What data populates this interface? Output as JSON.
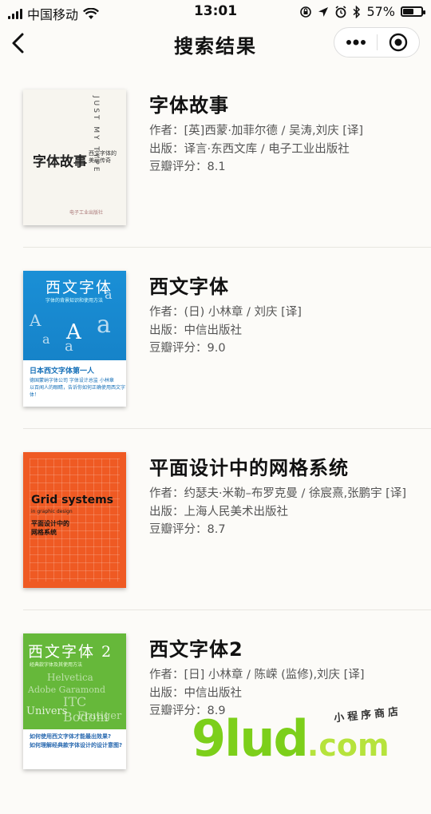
{
  "status_bar": {
    "carrier": "中国移动",
    "time": "13:01",
    "battery_percent": "57%",
    "battery_level": 0.57
  },
  "nav": {
    "title": "搜索结果"
  },
  "books": [
    {
      "title": "字体故事",
      "author": "作者：[英]西蒙·加菲尔德 / 吴涛,刘庆 [译]",
      "publisher": "出版：译言·东西文库 / 电子工业出版社",
      "rating": "豆瓣评分：8.1",
      "cover": {
        "main": "字体故事",
        "sub1": "西文字体的",
        "sub2": "美丽传奇",
        "vertical": "JUST MY TYPE",
        "pub": "电子工业出版社"
      }
    },
    {
      "title": "西文字体",
      "author": "作者：(日) 小林章 / 刘庆 [译]",
      "publisher": "出版：中信出版社",
      "rating": "豆瓣评分：9.0",
      "cover": {
        "main": "西文字体",
        "sub": "字体的背景知识和使用方法",
        "band1": "日本西文字体第一人",
        "band2": "德国蒙纳字体公司 字体设计总监 小林章",
        "band3": "以百闻人的眼睛，告诉你如何正确使用西文字体！"
      }
    },
    {
      "title": "平面设计中的网格系统",
      "author": "作者：约瑟夫·米勒–布罗克曼 / 徐宸熹,张鹏宇 [译]",
      "publisher": "出版：上海人民美术出版社",
      "rating": "豆瓣评分：8.7",
      "cover": {
        "main": "Grid systems",
        "sub": "in graphic design",
        "cn1": "平面设计中的",
        "cn2": "网格系统"
      }
    },
    {
      "title": "西文字体2",
      "author": "作者：[日] 小林章 / 陈嵘 (监修),刘庆 [译]",
      "publisher": "出版：中信出版社",
      "rating": "豆瓣评分：8.9",
      "cover": {
        "main": "西文字体 2",
        "sub": "经典款字体及其使用方法",
        "q1": "如何使用西文字体才能最出效果?",
        "q2": "如何理解经典款字体设计的设计意图?"
      }
    }
  ],
  "watermark": {
    "logo": "9lud",
    "domain": ".com",
    "tag": "小程序商店"
  }
}
